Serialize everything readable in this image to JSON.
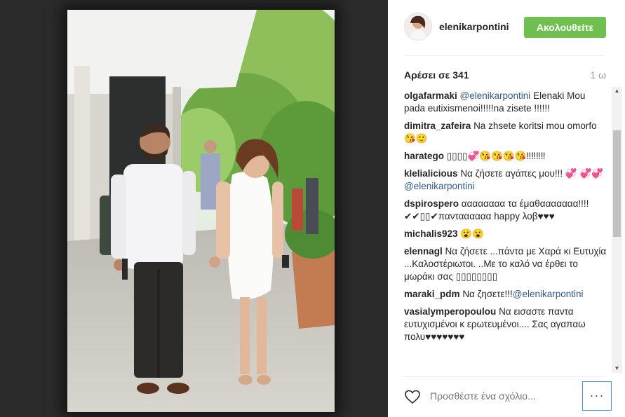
{
  "post": {
    "username": "elenikarpontini",
    "follow_label": "Ακολουθείτε",
    "likes_label": "Αρέσει σε 341",
    "time_label": "1 ω"
  },
  "comments": [
    {
      "user": "olgafarmaki",
      "mention": "@elenikarpontini",
      "text": "Elenaki Mou pada eutixismenoi!!!!!na zisete !!!!!!"
    },
    {
      "user": "dimitra_zafeira",
      "mention": "",
      "text": "Na zhsete koritsi mou omorfo😘🙂"
    },
    {
      "user": "haratego",
      "mention": "",
      "text": "▯▯▯▯💞😘😘😘😘‼‼‼‼"
    },
    {
      "user": "klelialicious",
      "mention": "",
      "text": "Να ζήσετε αγάπες μου!!! 💞 💞💞",
      "mention_after": "@elenikarpontini"
    },
    {
      "user": "dspirospero",
      "mention": "",
      "text": "αααααααα τα έμαθααααααα!!!! ✔✔▯▯✔πανταααααα happy λοβ♥♥♥"
    },
    {
      "user": "michalis923",
      "mention": "",
      "text": "😮😮"
    },
    {
      "user": "elennagl",
      "mention": "",
      "text": "Να ζήσετε ...πάντα με Χαρά κι Ευτυχία ...Καλοστέριωτοι. ..Με το καλό να έρθει το μωράκι σας ▯▯▯▯▯▯▯▯"
    },
    {
      "user": "maraki_pdm",
      "mention": "",
      "text": "Να ζησετε!!!",
      "mention_after": "@elenikarpontini"
    },
    {
      "user": "vasialymperopoulou",
      "mention": "",
      "text": "Να εισαστε παντα ευτυχισμένοι κ ερωτευμένοι.... Σας αγαπαω πολυ♥♥♥♥♥♥♥"
    }
  ],
  "comment_input_placeholder": "Προσθέστε ένα σχόλιο...",
  "more_label": "···",
  "colors": {
    "follow_green": "#70c050",
    "mention_blue": "#2f5a82",
    "background_dark": "#262626"
  }
}
